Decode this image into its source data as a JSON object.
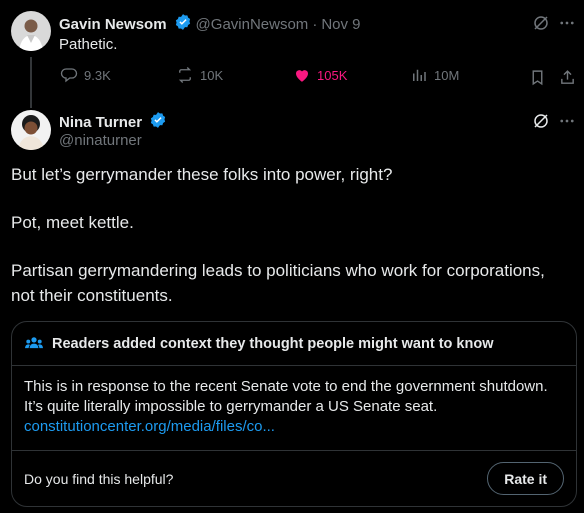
{
  "parent_tweet": {
    "author_name": "Gavin Newsom",
    "handle": "@GavinNewsom",
    "separator": "·",
    "date": "Nov 9",
    "text": "Pathetic.",
    "metrics": {
      "replies": "9.3K",
      "reposts": "10K",
      "likes": "105K",
      "views": "10M"
    },
    "liked": true
  },
  "main_tweet": {
    "author_name": "Nina Turner",
    "handle": "@ninaturner",
    "paragraphs": [
      "But let’s gerrymander these folks into power, right?",
      "Pot, meet kettle.",
      "Partisan gerrymandering leads to politicians who work for corporations,",
      "not their constituents."
    ]
  },
  "community_note": {
    "header": "Readers added context they thought people might want to know",
    "body_line1": "This is in response to the recent Senate vote to end the government shutdown.",
    "body_line2": "It’s quite literally impossible to gerrymander a US Senate seat.",
    "link": "constitutioncenter.org/media/files/co...",
    "question": "Do you find this helpful?",
    "rate_label": "Rate it"
  },
  "colors": {
    "background": "#000000",
    "text": "#e7e9ea",
    "muted": "#71767b",
    "verified": "#1d9bf0",
    "like": "#f91880",
    "link": "#1d9bf0",
    "border": "#2f3336"
  },
  "icons": [
    "grok-icon",
    "more-icon",
    "reply-icon",
    "repost-icon",
    "heart-icon",
    "views-icon",
    "bookmark-icon",
    "share-icon",
    "verified-icon",
    "people-icon"
  ]
}
